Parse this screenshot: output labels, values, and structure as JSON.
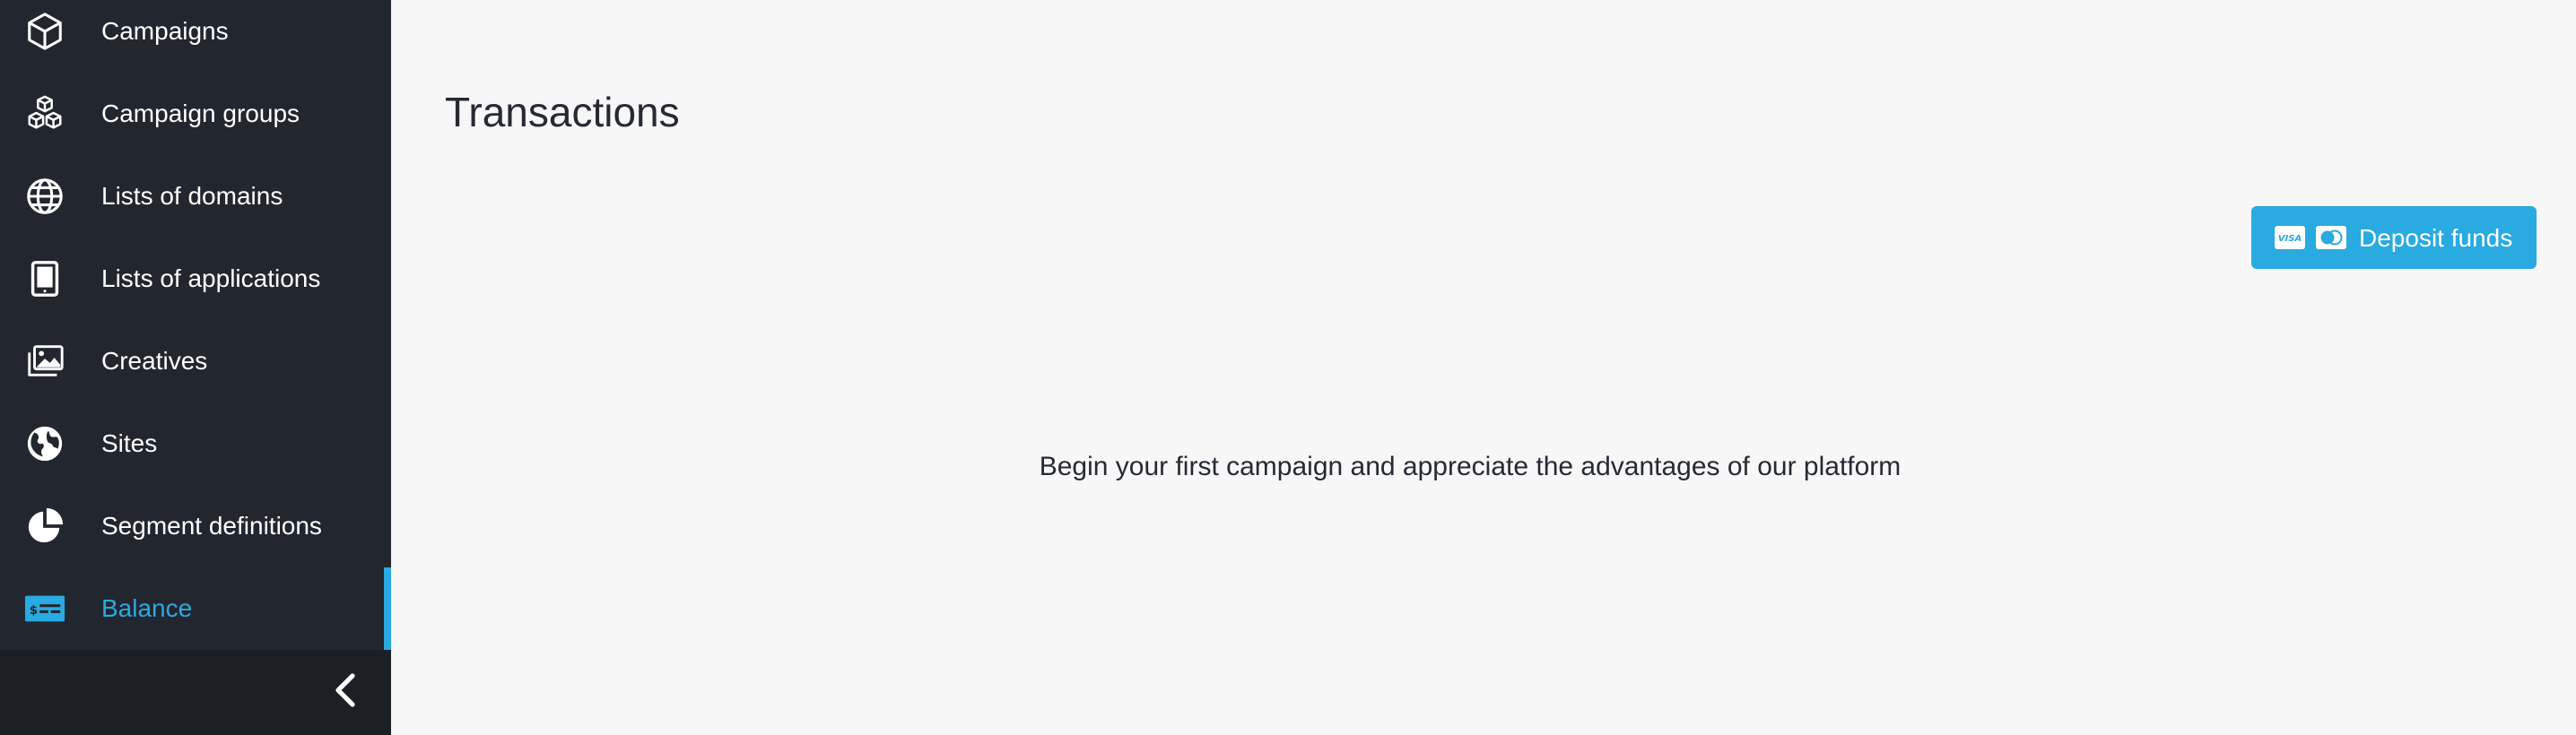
{
  "sidebar": {
    "items": [
      {
        "label": "Campaigns",
        "icon": "cube-icon"
      },
      {
        "label": "Campaign groups",
        "icon": "cubes-icon"
      },
      {
        "label": "Lists of domains",
        "icon": "globe-icon"
      },
      {
        "label": "Lists of applications",
        "icon": "tablet-icon"
      },
      {
        "label": "Creatives",
        "icon": "images-icon"
      },
      {
        "label": "Sites",
        "icon": "earth-icon"
      },
      {
        "label": "Segment definitions",
        "icon": "pie-chart-icon"
      },
      {
        "label": "Balance",
        "icon": "balance-icon",
        "active": true
      }
    ],
    "collapse_icon": "chevron-left-icon"
  },
  "main": {
    "title": "Transactions",
    "deposit_button": {
      "label": "Deposit funds",
      "icons": [
        "visa-card-icon",
        "mastercard-icon"
      ]
    },
    "empty_message": "Begin your first campaign and appreciate the advantages of our platform"
  },
  "colors": {
    "sidebar_bg": "#22262e",
    "sidebar_footer_bg": "#1c1f25",
    "accent": "#29aae1",
    "page_bg": "#f7f7f8",
    "text": "#262a33"
  }
}
